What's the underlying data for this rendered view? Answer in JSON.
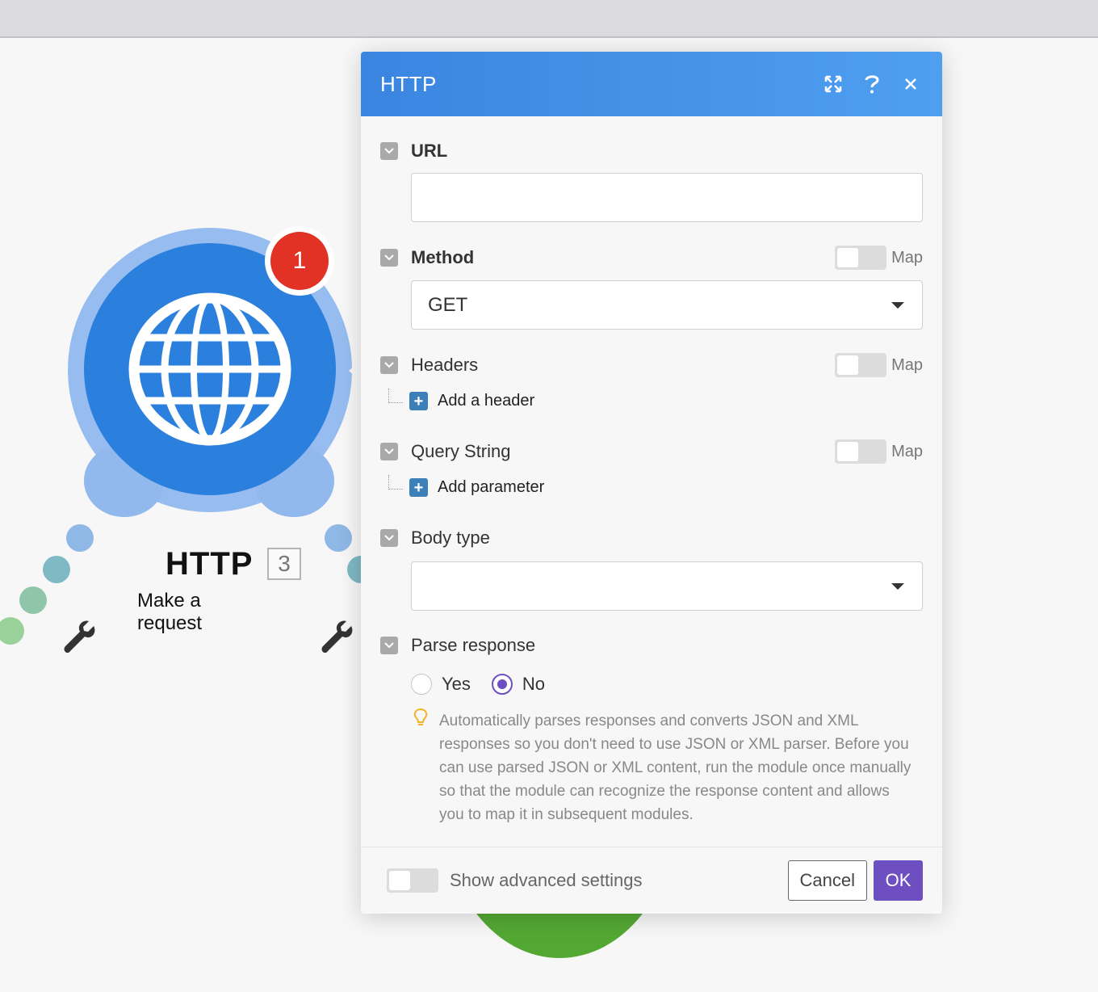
{
  "module": {
    "title": "HTTP",
    "number": "3",
    "subtitle": "Make a request",
    "badge_count": "1",
    "icon": "globe-icon"
  },
  "dialog": {
    "title": "HTTP",
    "header_icons": [
      "expand-icon",
      "help-icon",
      "close-icon"
    ],
    "fields": {
      "url": {
        "label": "URL",
        "value": ""
      },
      "method": {
        "label": "Method",
        "value": "GET",
        "map_label": "Map"
      },
      "headers": {
        "label": "Headers",
        "map_label": "Map",
        "add_label": "Add a header"
      },
      "query": {
        "label": "Query String",
        "map_label": "Map",
        "add_label": "Add parameter"
      },
      "body_type": {
        "label": "Body type",
        "value": ""
      },
      "parse": {
        "label": "Parse response",
        "yes_label": "Yes",
        "no_label": "No",
        "selected": "No",
        "hint": "Automatically parses responses and converts JSON and XML responses so you don't need to use JSON or XML parser. Before you can use parsed JSON or XML content, run the module once manually so that the module can recognize the response content and allows you to map it in subsequent modules."
      }
    },
    "footer": {
      "advanced_label": "Show advanced settings",
      "cancel_label": "Cancel",
      "ok_label": "OK"
    }
  },
  "colors": {
    "accent": "#6d4fc2",
    "header": "#3a85e0",
    "module": "#2c80dd",
    "badge": "#e23226"
  }
}
